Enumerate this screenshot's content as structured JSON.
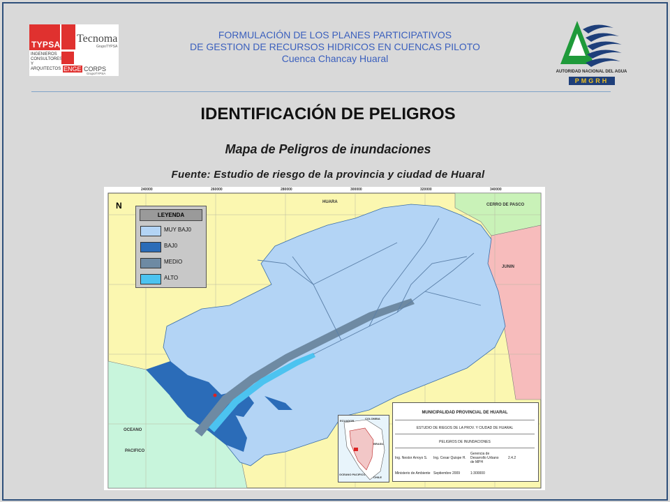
{
  "header": {
    "line1": "FORMULACIÓN DE LOS PLANES PARTICIPATIVOS",
    "line2": "DE GESTION DE RECURSOS HIDRICOS EN CUENCAS PILOTO",
    "line3": "Cuenca Chancay Huaral"
  },
  "logos": {
    "typsa": "TYPSA",
    "typsa_sub": "INGENIEROS CONSULTORES Y ARQUITECTOS",
    "tecnoma": "Tecnoma",
    "tecnoma_sub": "GrupoTYPSA",
    "engecorps_a": "ENGE",
    "engecorps_b": "CORPS",
    "engecorps_sub": "GrupoTYPSA",
    "ana": "AUTORIDAD NACIONAL DEL AGUA",
    "pmgrh": "PMGRH"
  },
  "slide": {
    "title": "IDENTIFICACIÓN DE PELIGROS",
    "subtitle": "Mapa de Peligros de inundaciones",
    "source": "Fuente: Estudio de riesgo de la provincia y ciudad de Huaral"
  },
  "map": {
    "north": "N",
    "legend_title": "LEYENDA",
    "legend": [
      {
        "label": "MUY BAJ0",
        "color": "#b3d4f5"
      },
      {
        "label": "BAJ0",
        "color": "#2b6cb8"
      },
      {
        "label": "MEDIO",
        "color": "#6e8aa3"
      },
      {
        "label": "ALTO",
        "color": "#4cc3f0"
      }
    ],
    "places": {
      "huara": "HUARA",
      "cerro": "CERRO DE PASCO",
      "junin": "JUNIN",
      "oceano": "OCEANO",
      "pacifico": "PACIFICO"
    },
    "grid_x": [
      "240000",
      "260000",
      "280000",
      "300000",
      "320000",
      "340000"
    ],
    "title_block": {
      "entity": "MUNICIPALIDAD PROVINCIAL DE HUARAL",
      "study": "ESTUDIO DE RIEGOS DE LA PROV. Y CIUDAD DE HUARAL",
      "map_name": "PELIGROS DE INUNDACIONES",
      "responsible": "Ing. Nestor Arroyo S.",
      "reviewer": "Ing. Cesar Quispe H.",
      "office": "Gerencia de Desarrollo Urbano de MPH",
      "sheet": "2.4.2",
      "ministry": "Ministerio de Ambiente",
      "date": "Septiembre 2009",
      "scale": "1:300000"
    },
    "inset": {
      "ecuador": "ECUADOR",
      "colombia": "COLOMBIA",
      "brasil": "BRASIL",
      "ocean": "OCEANO PACIFICO",
      "chile": "CHILE"
    }
  }
}
